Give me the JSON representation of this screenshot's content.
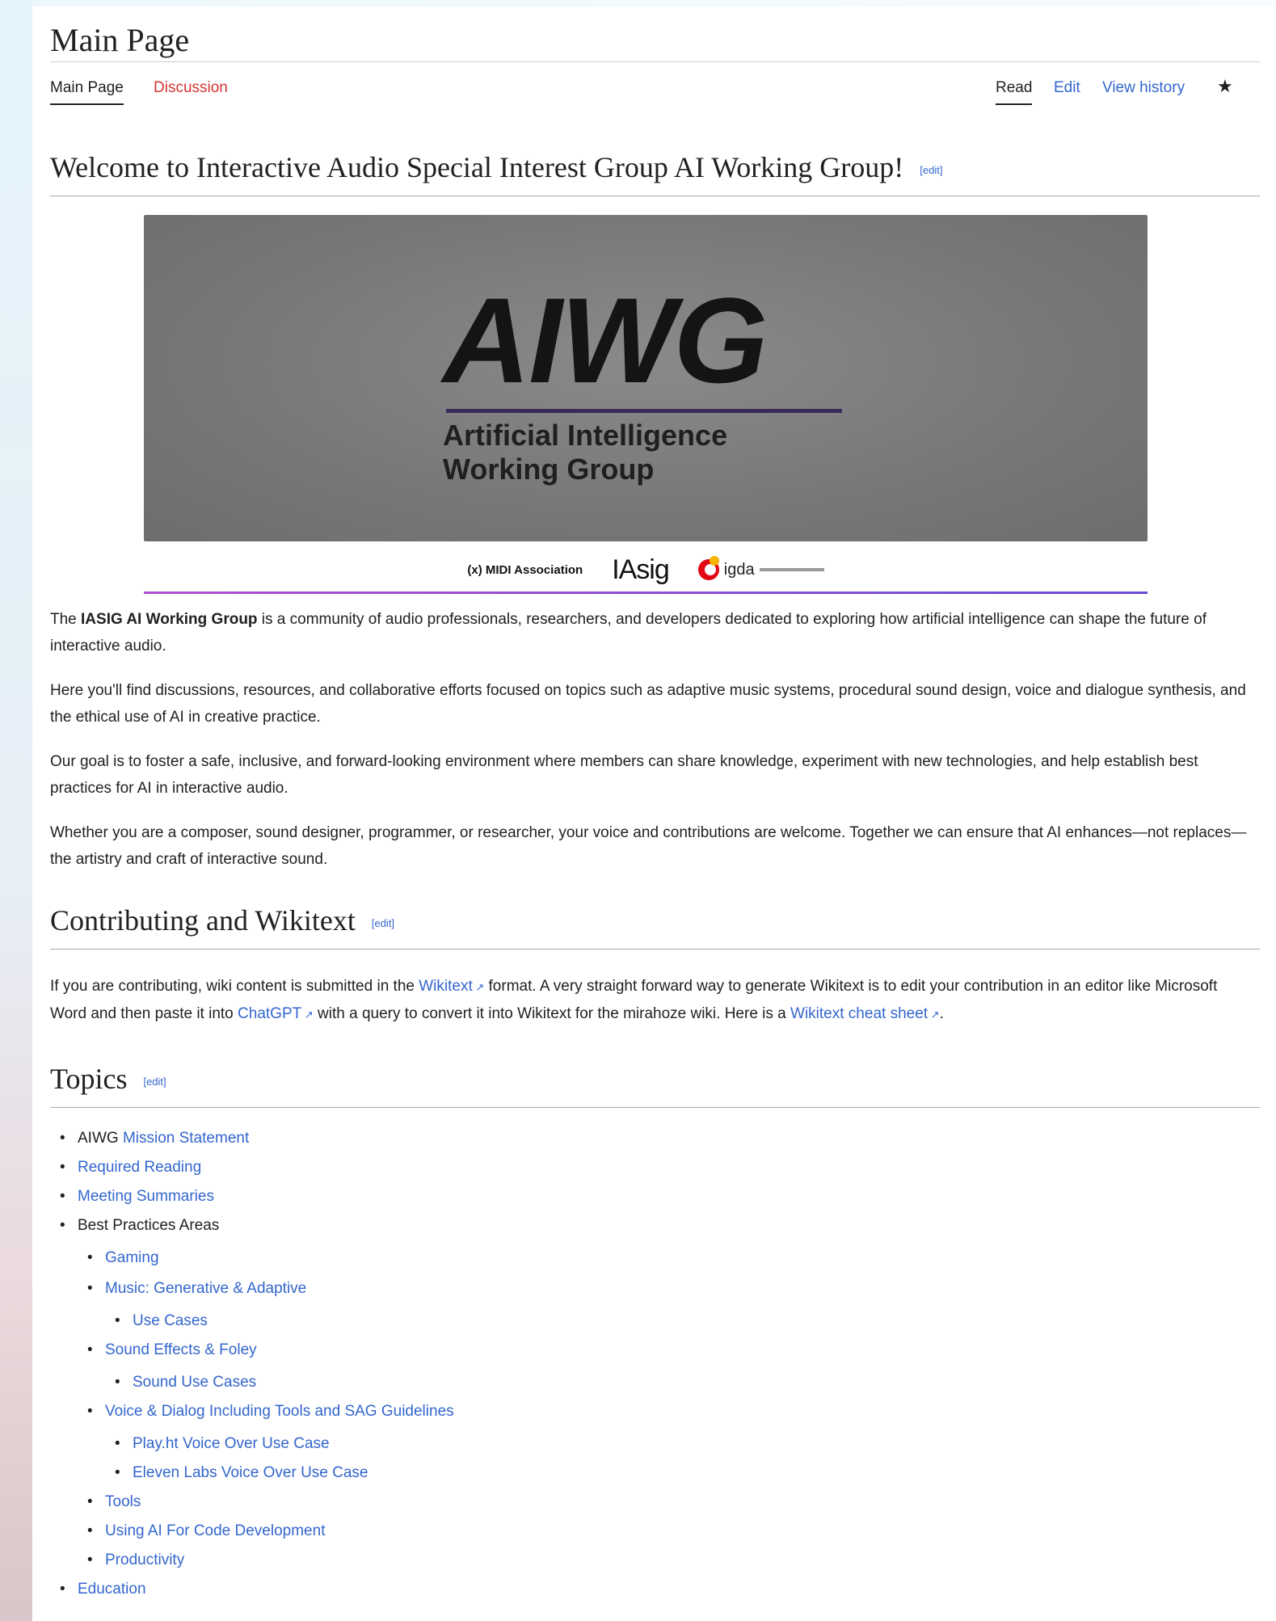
{
  "page": {
    "title": "Main Page",
    "tabs_left": [
      "Main Page",
      "Discussion"
    ],
    "tabs_right": [
      "Read",
      "Edit",
      "View history"
    ],
    "star": "★"
  },
  "welcome": {
    "heading": "Welcome to Interactive Audio Special Interest Group AI Working Group!",
    "edit": "[edit]"
  },
  "banner": {
    "logo_text": "AIWG",
    "subtitle_line1": "Artificial Intelligence",
    "subtitle_line2": "Working Group",
    "partner_midi": "(x) MIDI Association",
    "partner_iasig": "IAsig",
    "partner_igda": "igda"
  },
  "intro": {
    "p1_pre": "The ",
    "p1_bold": "IASIG AI Working Group",
    "p1_post": " is a community of audio professionals, researchers, and developers dedicated to exploring how artificial intelligence can shape the future of interactive audio.",
    "p2": "Here you'll find discussions, resources, and collaborative efforts focused on topics such as adaptive music systems, procedural sound design, voice and dialogue synthesis, and the ethical use of AI in creative practice.",
    "p3": "Our goal is to foster a safe, inclusive, and forward-looking environment where members can share knowledge, experiment with new technologies, and help establish best practices for AI in interactive audio.",
    "p4": "Whether you are a composer, sound designer, programmer, or researcher, your voice and contributions are welcome. Together we can ensure that AI enhances—not replaces—the artistry and craft of interactive sound."
  },
  "contributing": {
    "heading": "Contributing and Wikitext",
    "edit": "[edit]",
    "text_1": "If you are contributing, wiki content is submitted in the ",
    "link_wikitext": "Wikitext",
    "text_2": " format. A very straight forward way to generate Wikitext is to edit your contribution in an editor like Microsoft Word and then paste it into ",
    "link_chatgpt": "ChatGPT",
    "text_3": " with a query to convert it into Wikitext for the mirahoze wiki. Here is a ",
    "link_cheat": "Wikitext cheat sheet",
    "text_4": "."
  },
  "topics": {
    "heading": "Topics",
    "edit": "[edit]",
    "items": [
      {
        "prefix": "AIWG ",
        "label": "Mission Statement",
        "level": 0,
        "link": true
      },
      {
        "prefix": "",
        "label": "Required Reading",
        "level": 0,
        "link": true
      },
      {
        "prefix": "",
        "label": "Meeting Summaries",
        "level": 0,
        "link": true
      },
      {
        "prefix": "",
        "label": "Best Practices Areas",
        "level": 0,
        "link": false
      },
      {
        "prefix": "",
        "label": "Gaming",
        "level": 1,
        "link": true
      },
      {
        "prefix": "",
        "label": "Music: Generative & Adaptive",
        "level": 1,
        "link": true
      },
      {
        "prefix": "",
        "label": "Use Cases",
        "level": 2,
        "link": true
      },
      {
        "prefix": "",
        "label": "Sound Effects & Foley",
        "level": 1,
        "link": true
      },
      {
        "prefix": "",
        "label": "Sound Use Cases",
        "level": 2,
        "link": true
      },
      {
        "prefix": "",
        "label": "Voice & Dialog Including Tools and SAG Guidelines",
        "level": 1,
        "link": true
      },
      {
        "prefix": "",
        "label": "Play.ht Voice Over Use Case",
        "level": 2,
        "link": true
      },
      {
        "prefix": "",
        "label": "Eleven Labs Voice Over Use Case",
        "level": 2,
        "link": true
      },
      {
        "prefix": "",
        "label": "Tools",
        "level": 1,
        "link": true
      },
      {
        "prefix": "",
        "label": "Using AI For Code Development",
        "level": 1,
        "link": true
      },
      {
        "prefix": "",
        "label": "Productivity",
        "level": 1,
        "link": true
      },
      {
        "prefix": "",
        "label": "Education",
        "level": 0,
        "link": true
      }
    ]
  },
  "colors": {
    "link": "#3366cc",
    "redlink": "#d73333",
    "text": "#202122"
  }
}
